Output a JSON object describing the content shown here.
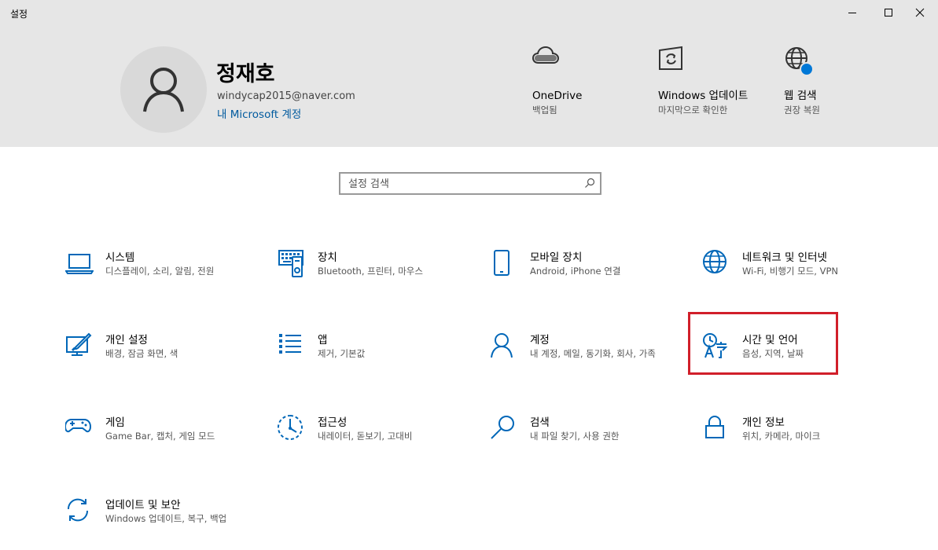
{
  "window": {
    "title": "설정",
    "minimize_icon": "minimize-icon",
    "maximize_icon": "maximize-icon",
    "close_icon": "close-icon"
  },
  "account": {
    "name": "정재호",
    "email": "windycap2015@naver.com",
    "link": "내 Microsoft 계정",
    "avatar_icon": "person-icon"
  },
  "quick_actions": [
    {
      "title": "OneDrive",
      "subtitle": "백업됨",
      "icon": "cloud-icon"
    },
    {
      "title": "Windows 업데이트",
      "subtitle": "마지막으로 확인한",
      "icon": "windows-update-icon"
    },
    {
      "title": "웹 검색",
      "subtitle": "권장 복원",
      "icon": "globe-icon"
    }
  ],
  "search": {
    "placeholder": "설정 검색",
    "icon": "search-icon"
  },
  "categories": [
    {
      "title": "시스템",
      "subtitle": "디스플레이, 소리, 알림, 전원",
      "icon": "laptop-icon"
    },
    {
      "title": "장치",
      "subtitle": "Bluetooth, 프린터, 마우스",
      "icon": "keyboard-device-icon"
    },
    {
      "title": "모바일 장치",
      "subtitle": "Android, iPhone 연결",
      "icon": "phone-icon"
    },
    {
      "title": "네트워크 및 인터넷",
      "subtitle": "Wi-Fi, 비행기 모드, VPN",
      "icon": "network-globe-icon"
    },
    {
      "title": "개인 설정",
      "subtitle": "배경, 잠금 화면, 색",
      "icon": "personalization-icon"
    },
    {
      "title": "앱",
      "subtitle": "제거, 기본값",
      "icon": "apps-list-icon"
    },
    {
      "title": "계정",
      "subtitle": "내 계정, 메일, 동기화, 회사, 가족",
      "icon": "account-icon"
    },
    {
      "title": "시간 및 언어",
      "subtitle": "음성, 지역, 날짜",
      "icon": "time-language-icon"
    },
    {
      "title": "게임",
      "subtitle": "Game Bar, 캡처, 게임 모드",
      "icon": "gamepad-icon"
    },
    {
      "title": "접근성",
      "subtitle": "내레이터, 돋보기, 고대비",
      "icon": "accessibility-icon"
    },
    {
      "title": "검색",
      "subtitle": "내 파일 찾기, 사용 권한",
      "icon": "magnifier-icon"
    },
    {
      "title": "개인 정보",
      "subtitle": "위치, 카메라, 마이크",
      "icon": "lock-icon"
    },
    {
      "title": "업데이트 및 보안",
      "subtitle": "Windows 업데이트, 복구, 백업",
      "icon": "sync-icon"
    }
  ],
  "colors": {
    "accent": "#005a9e",
    "icon_blue": "#0067b8",
    "header_bg": "#e6e6e6",
    "highlight_border": "#d11f2a"
  }
}
